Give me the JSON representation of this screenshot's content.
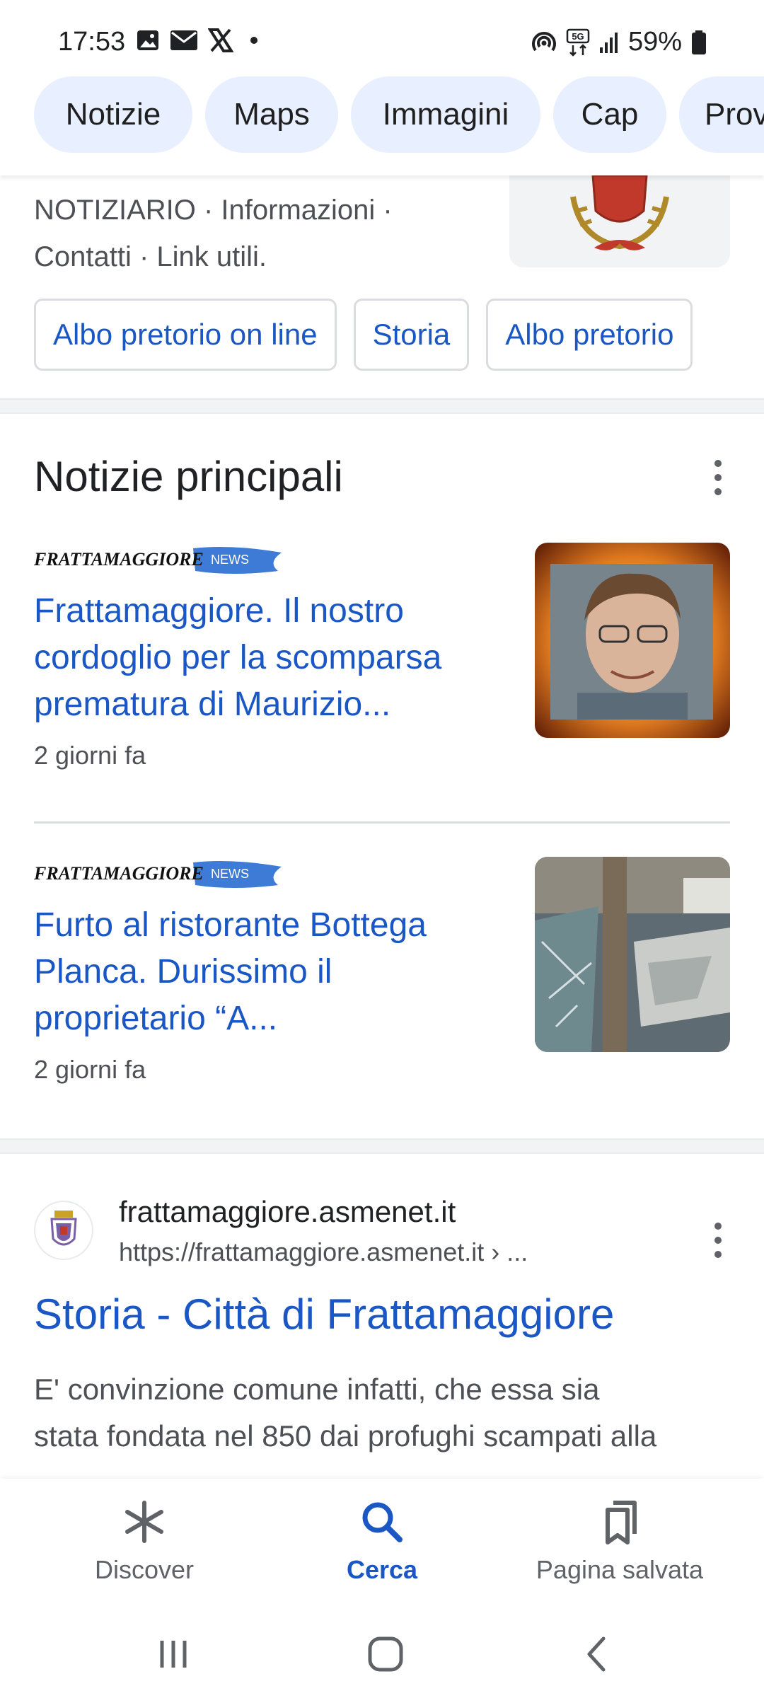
{
  "status_bar": {
    "time": "17:53",
    "battery_text": "59%",
    "icons": [
      "gallery-icon",
      "mail-icon",
      "x-icon",
      "dot-icon",
      "hotspot-icon",
      "5g-icon",
      "signal-icon",
      "battery-icon"
    ]
  },
  "chips": [
    "Notizie",
    "Maps",
    "Immagini",
    "Cap",
    "Prov"
  ],
  "top_result": {
    "snippet_line1": "NOTIZIARIO · Informazioni ·",
    "snippet_line2": "Contatti · Link utili.",
    "sitelinks": [
      "Albo pretorio on line",
      "Storia",
      "Albo pretorio"
    ]
  },
  "news": {
    "heading": "Notizie principali",
    "items": [
      {
        "source": "FRATTAMAGGIORE",
        "source_badge": "NEWS",
        "title_line1": "Frattamaggiore. Il nostro",
        "title_line2": "cordoglio per la scomparsa",
        "title_line3": "prematura di Maurizio...",
        "time": "2 giorni fa"
      },
      {
        "source": "FRATTAMAGGIORE",
        "source_badge": "NEWS",
        "title_line1": "Furto al ristorante Bottega",
        "title_line2": "Planca. Durissimo il",
        "title_line3": "proprietario “A...",
        "time": "2 giorni fa"
      }
    ]
  },
  "result": {
    "site": "frattamaggiore.asmenet.it",
    "url": "https://frattamaggiore.asmenet.it › ...",
    "title": "Storia - Città di Frattamaggiore",
    "snippet_line1": "E' convinzione comune infatti, che essa sia",
    "snippet_line2": "stata fondata nel 850 dai profughi scampati alla"
  },
  "bottom_nav": {
    "items": [
      {
        "label": "Discover",
        "icon": "asterisk-icon"
      },
      {
        "label": "Cerca",
        "icon": "search-icon",
        "active": true
      },
      {
        "label": "Pagina salvata",
        "icon": "bookmarks-icon"
      }
    ]
  },
  "colors": {
    "link": "#1a57c5",
    "chip_bg": "#e8efff",
    "text": "#202124",
    "muted": "#4d5156"
  }
}
